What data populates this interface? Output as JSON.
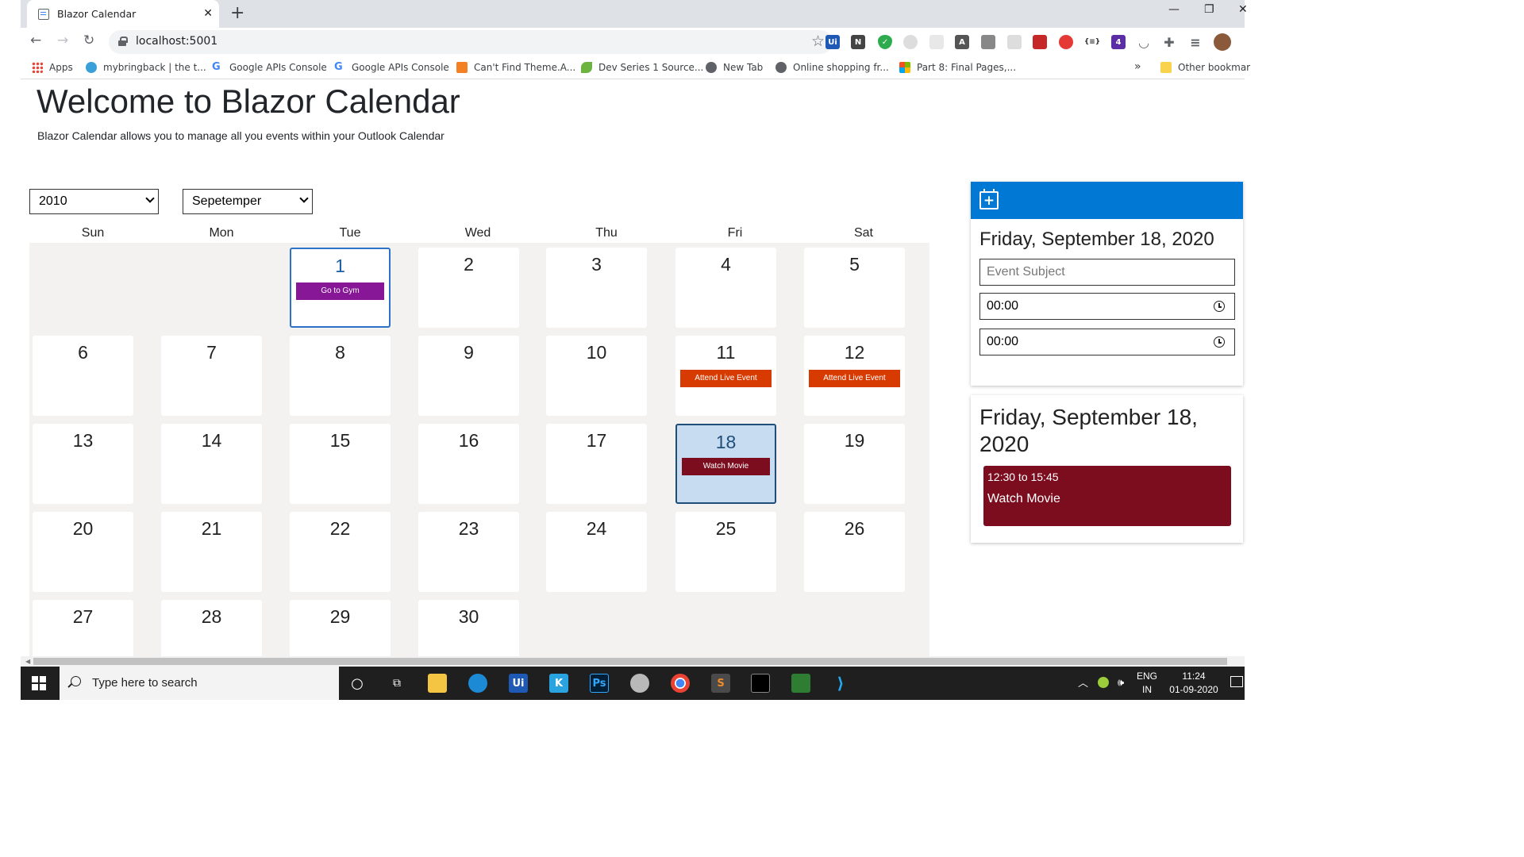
{
  "browser": {
    "tab_title": "Blazor Calendar",
    "tab_close": "✕",
    "new_tab": "+",
    "url": "localhost:5001",
    "window_controls": [
      "—",
      "❐",
      "✕"
    ],
    "bookmarks": [
      {
        "label": "Apps",
        "icon": "apps-grid-icon"
      },
      {
        "label": "mybringback | the t...",
        "icon": "mybringback-icon"
      },
      {
        "label": "Google APIs Console",
        "icon": "google-icon"
      },
      {
        "label": "Google APIs Console",
        "icon": "google-icon"
      },
      {
        "label": "Can't Find Theme.A...",
        "icon": "stackoverflow-icon"
      },
      {
        "label": "Dev Series 1 Source...",
        "icon": "rocket-icon"
      },
      {
        "label": "New Tab",
        "icon": "globe-icon"
      },
      {
        "label": "Online shopping fr...",
        "icon": "globe-icon"
      },
      {
        "label": "Part 8: Final Pages,...",
        "icon": "microsoft-icon"
      }
    ],
    "bookmarks_overflow": "»",
    "other_bookmarks": "Other bookmar"
  },
  "page": {
    "title": "Welcome to Blazor Calendar",
    "subtitle": "Blazor Calendar allows you to manage all you events within your Outlook Calendar",
    "year_select": "2010",
    "month_select": "Sepetemper",
    "day_names": [
      "Sun",
      "Mon",
      "Tue",
      "Wed",
      "Thu",
      "Fri",
      "Sat"
    ],
    "days": [
      "1",
      "2",
      "3",
      "4",
      "5",
      "6",
      "7",
      "8",
      "9",
      "10",
      "11",
      "12",
      "13",
      "14",
      "15",
      "16",
      "17",
      "18",
      "19",
      "20",
      "21",
      "22",
      "23",
      "24",
      "25",
      "26",
      "27",
      "28",
      "29",
      "30"
    ],
    "events": {
      "d1": "Go to Gym",
      "d11": "Attend Live Event",
      "d12": "Attend Live Event",
      "d18": "Watch Movie"
    }
  },
  "new_event_panel": {
    "date": "Friday, September 18, 2020",
    "subject_placeholder": "Event Subject",
    "start_time": "00:00",
    "end_time": "00:00"
  },
  "day_panel": {
    "date": "Friday, September 18, 2020",
    "event_time": "12:30 to 15:45",
    "event_title": "Watch Movie"
  },
  "colors": {
    "accent": "#0078d4",
    "gym_event": "#881798",
    "live_event": "#d83b01",
    "movie_event": "#7b0d1e",
    "selected_day": "#c7dcf0"
  },
  "taskbar": {
    "search_placeholder": "Type here to search",
    "lang": "ENG",
    "region": "IN",
    "time": "11:24",
    "date": "01-09-2020"
  }
}
